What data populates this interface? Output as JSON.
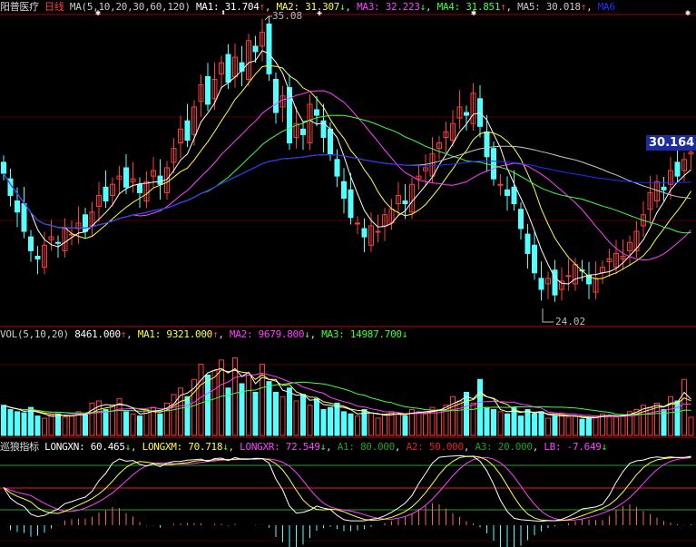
{
  "main_header": {
    "stock_name": "阳普医疗",
    "period": "日线",
    "ma_params": "MA(5,10,20,30,60,120)",
    "items": [
      {
        "label": "MA1: ",
        "value": "31.704",
        "arrow": "↑",
        "color": "#ffffff",
        "arrow_color": "#ff4040"
      },
      {
        "label": "MA2: ",
        "value": "31.307",
        "arrow": "↓",
        "color": "#ffff40",
        "arrow_color": "#40ff40"
      },
      {
        "label": "MA3: ",
        "value": "32.223",
        "arrow": "↓",
        "color": "#ff40ff",
        "arrow_color": "#40ff40"
      },
      {
        "label": "MA4: ",
        "value": "31.851",
        "arrow": "↑",
        "color": "#40ff40",
        "arrow_color": "#ff4040"
      },
      {
        "label": "MA5: ",
        "value": "30.018",
        "arrow": "↑",
        "color": "#c8c8c8",
        "arrow_color": "#ff4040"
      },
      {
        "label": "MA6",
        "value": "",
        "arrow": "",
        "color": "#2030ff",
        "arrow_color": "#2030ff"
      }
    ]
  },
  "vol_header": {
    "label": "VOL(5,10,20)",
    "value": "8461.000",
    "arrow": "↑",
    "items": [
      {
        "label": "MA1: ",
        "value": "9321.000",
        "arrow": "↑",
        "color": "#ffff40",
        "arrow_color": "#ff4040"
      },
      {
        "label": "MA2: ",
        "value": "9679.800",
        "arrow": "↓",
        "color": "#ff40ff",
        "arrow_color": "#40ff40"
      },
      {
        "label": "MA3: ",
        "value": "14987.700",
        "arrow": "↓",
        "color": "#40ff40",
        "arrow_color": "#40ff40"
      }
    ]
  },
  "ind_header": {
    "name": "巡狼指标",
    "items": [
      {
        "label": "LONGXN: ",
        "value": "60.465",
        "arrow": "↓",
        "color": "#ffffff",
        "arrow_color": "#40ff40"
      },
      {
        "label": "LONGXM: ",
        "value": "70.718",
        "arrow": "↓",
        "color": "#ffff40",
        "arrow_color": "#40ff40"
      },
      {
        "label": "LONGXR: ",
        "value": "72.549",
        "arrow": "↓",
        "color": "#ff40ff",
        "arrow_color": "#40ff40"
      },
      {
        "label": "A1: ",
        "value": "80.000",
        "arrow": "",
        "color": "#20a020",
        "arrow_color": ""
      },
      {
        "label": "A2: ",
        "value": "50.000",
        "arrow": "",
        "color": "#e02020",
        "arrow_color": ""
      },
      {
        "label": "A3: ",
        "value": "20.000",
        "arrow": "",
        "color": "#20a020",
        "arrow_color": ""
      },
      {
        "label": "LB: ",
        "value": "-7.649",
        "arrow": "↓",
        "color": "#ff40ff",
        "arrow_color": "#40ff40"
      }
    ]
  },
  "current_price": "30.164",
  "high_label": "35.08",
  "low_label": "24.02",
  "chart_data": {
    "type": "candlestick",
    "price_range": [
      24.02,
      35.08
    ],
    "ma_periods": [
      5,
      10,
      20,
      30,
      60,
      120
    ],
    "ma_colors": [
      "#ffffff",
      "#ffff40",
      "#ff40ff",
      "#40ff40",
      "#c8c8c8",
      "#2030ff"
    ],
    "up_color": "#ff3c3c",
    "down_color": "#54ffff",
    "closes": [
      29.4,
      28.6,
      28.0,
      27.3,
      26.6,
      26.3,
      26.8,
      27.1,
      26.9,
      27.4,
      27.2,
      27.6,
      27.3,
      28.0,
      28.6,
      28.4,
      29.0,
      29.3,
      28.9,
      29.2,
      28.7,
      29.1,
      29.5,
      29.0,
      29.6,
      30.3,
      31.0,
      30.6,
      31.8,
      32.6,
      31.9,
      32.8,
      33.4,
      32.7,
      33.6,
      33.1,
      34.2,
      33.8,
      34.5,
      33.0,
      31.6,
      32.2,
      30.5,
      31.2,
      30.8,
      31.9,
      31.5,
      30.7,
      30.1,
      29.3,
      28.5,
      27.8,
      27.6,
      27.1,
      27.5,
      27.3,
      27.9,
      28.1,
      28.6,
      28.3,
      29.0,
      29.3,
      29.6,
      30.1,
      30.5,
      30.9,
      31.2,
      31.8,
      31.5,
      32.3,
      31.1,
      30.0,
      29.2,
      29.0,
      28.6,
      28.3,
      27.4,
      26.5,
      25.8,
      25.2,
      25.6,
      25.0,
      25.5,
      25.7,
      26.1,
      25.9,
      25.4,
      25.6,
      26.0,
      26.3,
      26.5,
      26.4,
      26.9,
      27.3,
      27.9,
      28.7,
      29.1,
      28.8,
      29.5,
      29.3,
      29.9,
      30.164
    ],
    "volumes": [
      14000,
      12000,
      11000,
      10500,
      13000,
      9000,
      8000,
      9500,
      10000,
      8500,
      9000,
      11000,
      9500,
      15000,
      16000,
      12000,
      14000,
      17000,
      11000,
      10000,
      9000,
      12000,
      13000,
      10000,
      15000,
      19000,
      22000,
      18000,
      26000,
      33000,
      28000,
      30000,
      35000,
      22000,
      36000,
      24000,
      28000,
      20000,
      33000,
      25000,
      20000,
      18000,
      22000,
      16000,
      19000,
      14000,
      17000,
      12000,
      13000,
      15000,
      11000,
      10000,
      9000,
      12000,
      10500,
      8000,
      9500,
      11000,
      10000,
      9000,
      12000,
      11000,
      10000,
      13000,
      12000,
      14000,
      18000,
      16000,
      20000,
      15000,
      26000,
      13000,
      12000,
      11000,
      10000,
      13000,
      9000,
      12000,
      10000,
      11000,
      8000,
      9000,
      10000,
      8500,
      9000,
      7500,
      8000,
      9000,
      10000,
      9000,
      8500,
      9500,
      11000,
      12000,
      14000,
      13000,
      15000,
      12000,
      18000,
      16000,
      26000,
      8461
    ],
    "vol_ma_periods": [
      5,
      10,
      20
    ],
    "vol_max": 40000,
    "indicator_levels": [
      80,
      50,
      20
    ]
  }
}
